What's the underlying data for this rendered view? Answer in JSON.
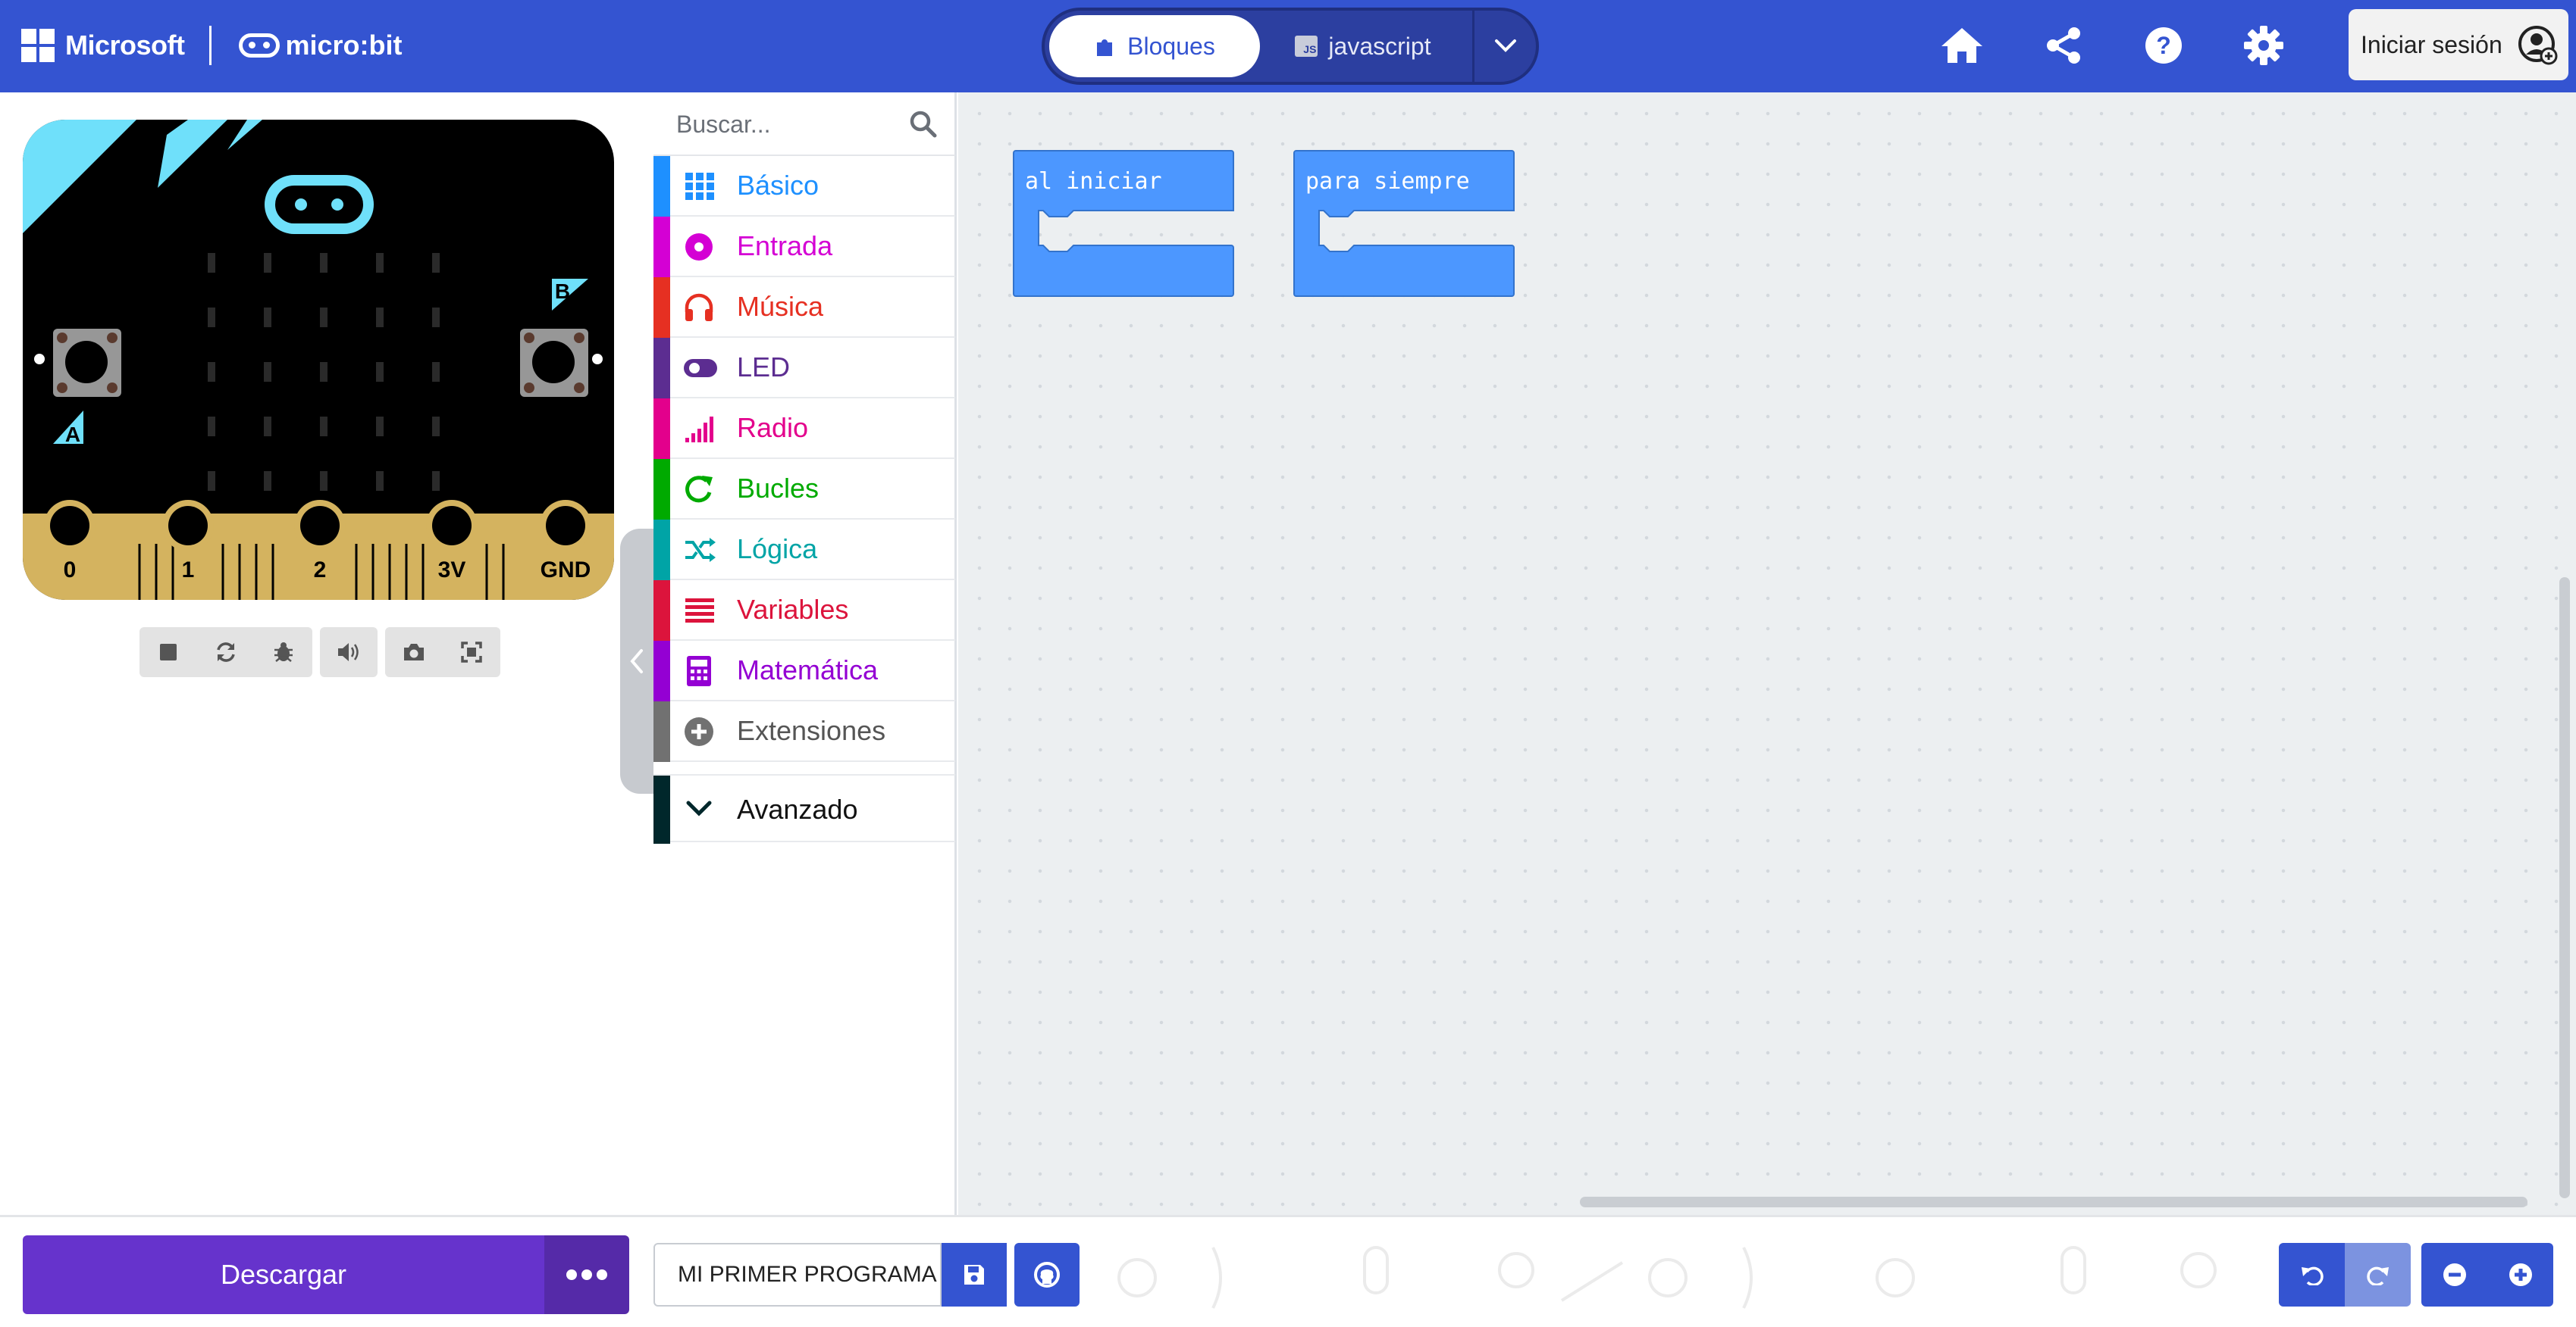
{
  "header": {
    "brand_microsoft": "Microsoft",
    "brand_microbit": "micro:bit",
    "mode_blocks": "Bloques",
    "mode_js": "javascript",
    "js_badge": "JS",
    "signin": "Iniciar sesión",
    "icons": [
      "home-icon",
      "share-icon",
      "help-icon",
      "settings-icon"
    ]
  },
  "simulator": {
    "buttons": [
      "A",
      "B"
    ],
    "pins": [
      "0",
      "1",
      "2",
      "3V",
      "GND"
    ],
    "controls": [
      "stop-icon",
      "restart-icon",
      "debug-icon",
      "sound-icon",
      "screenshot-icon",
      "fullscreen-icon"
    ]
  },
  "toolbox": {
    "search_placeholder": "Buscar...",
    "categories": [
      {
        "label": "Básico",
        "color": "#1E90FF",
        "icon": "grid-icon"
      },
      {
        "label": "Entrada",
        "color": "#D400D4",
        "icon": "input-icon"
      },
      {
        "label": "Música",
        "color": "#E63022",
        "icon": "headphones-icon"
      },
      {
        "label": "LED",
        "color": "#5C2D91",
        "icon": "toggle-icon"
      },
      {
        "label": "Radio",
        "color": "#E3008C",
        "icon": "signal-icon"
      },
      {
        "label": "Bucles",
        "color": "#00AA00",
        "icon": "loop-icon"
      },
      {
        "label": "Lógica",
        "color": "#00A4A6",
        "icon": "shuffle-icon"
      },
      {
        "label": "Variables",
        "color": "#DC143C",
        "icon": "list-icon"
      },
      {
        "label": "Matemática",
        "color": "#9400D3",
        "icon": "calculator-icon"
      },
      {
        "label": "Extensiones",
        "color": "#717171",
        "icon": "plus-circle-icon"
      },
      {
        "label": "Avanzado",
        "color": "#00272B",
        "icon": "chevron-down-icon"
      }
    ]
  },
  "workspace": {
    "blocks": [
      {
        "label": "al iniciar"
      },
      {
        "label": "para siempre"
      }
    ]
  },
  "bottom": {
    "download": "Descargar",
    "project_name": "MI PRIMER PROGRAMA"
  },
  "colors": {
    "header": "#3454D1",
    "block": "#4C97FF",
    "download": "#6633CC",
    "workspace": "#ECEFF1"
  }
}
